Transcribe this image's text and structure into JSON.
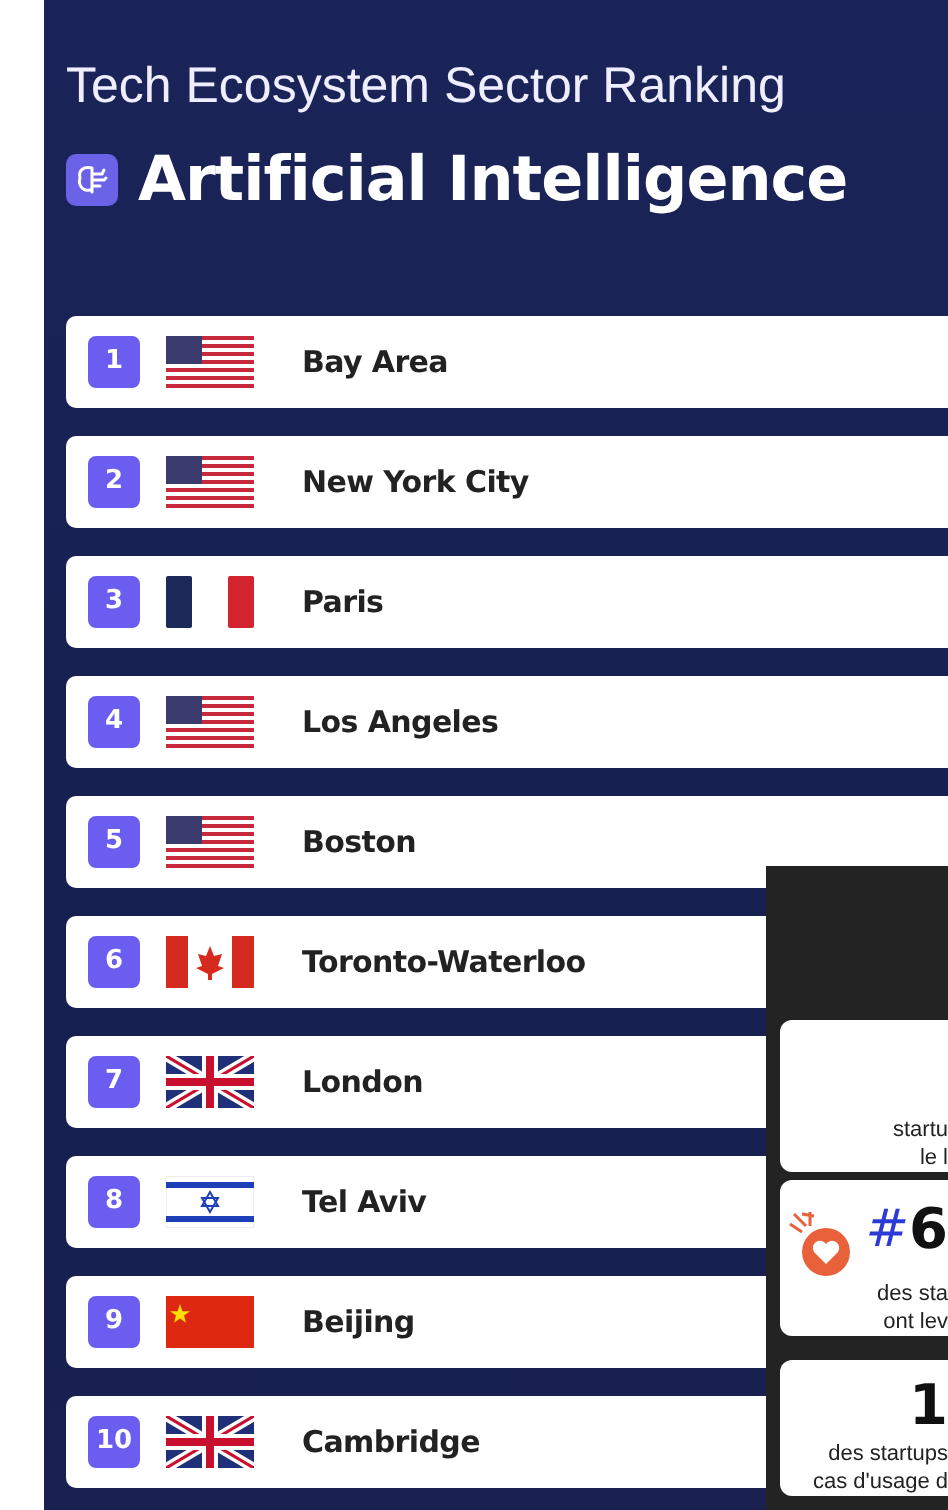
{
  "header": {
    "title": "Tech Ecosystem Sector Ranking",
    "sector": "Artificial Intelligence"
  },
  "rankings": [
    {
      "rank": "1",
      "kind": "us",
      "city": "Bay Area"
    },
    {
      "rank": "2",
      "kind": "us",
      "city": "New York City"
    },
    {
      "rank": "3",
      "kind": "fr",
      "city": "Paris"
    },
    {
      "rank": "4",
      "kind": "us",
      "city": "Los Angeles"
    },
    {
      "rank": "5",
      "kind": "us",
      "city": "Boston"
    },
    {
      "rank": "6",
      "kind": "ca",
      "city": "Toronto-Waterloo"
    },
    {
      "rank": "7",
      "kind": "gb",
      "city": "London"
    },
    {
      "rank": "8",
      "kind": "il",
      "city": "Tel Aviv"
    },
    {
      "rank": "9",
      "kind": "cn",
      "city": "Beijing"
    },
    {
      "rank": "10",
      "kind": "gb",
      "city": "Cambridge"
    }
  ],
  "overlay": {
    "cards": [
      {
        "kind": "text",
        "lines": [
          "startu",
          "le l"
        ]
      },
      {
        "kind": "heart",
        "figure_mark": "#",
        "figure": "6",
        "lines": [
          "des sta",
          "ont lev"
        ]
      },
      {
        "kind": "figure",
        "figure": "1",
        "lines": [
          "des startups",
          "cas d'usage d"
        ]
      }
    ]
  }
}
